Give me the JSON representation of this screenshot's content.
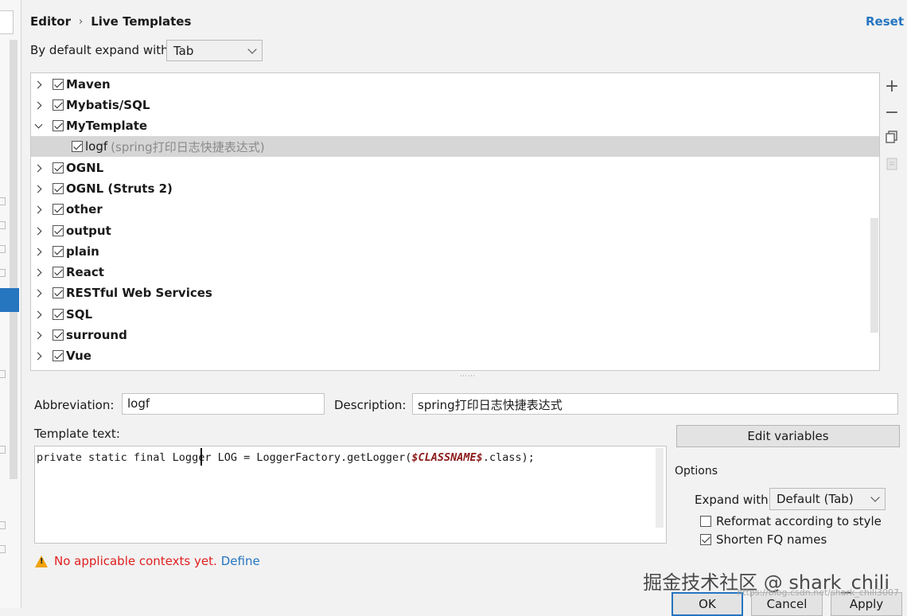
{
  "header": {
    "breadcrumb": [
      "Editor",
      "Live Templates"
    ],
    "breadcrumb_sep": "›",
    "reset_label": "Reset"
  },
  "expand_default": {
    "label": "By default expand with",
    "value": "Tab"
  },
  "tree": {
    "groups": [
      {
        "name": "Maven",
        "checked": true,
        "expanded": false
      },
      {
        "name": "Mybatis/SQL",
        "checked": true,
        "expanded": false
      },
      {
        "name": "MyTemplate",
        "checked": true,
        "expanded": true
      },
      {
        "name": "OGNL",
        "checked": true,
        "expanded": false
      },
      {
        "name": "OGNL (Struts 2)",
        "checked": true,
        "expanded": false
      },
      {
        "name": "other",
        "checked": true,
        "expanded": false
      },
      {
        "name": "output",
        "checked": true,
        "expanded": false
      },
      {
        "name": "plain",
        "checked": true,
        "expanded": false
      },
      {
        "name": "React",
        "checked": true,
        "expanded": false
      },
      {
        "name": "RESTful Web Services",
        "checked": true,
        "expanded": false
      },
      {
        "name": "SQL",
        "checked": true,
        "expanded": false
      },
      {
        "name": "surround",
        "checked": true,
        "expanded": false
      },
      {
        "name": "Vue",
        "checked": true,
        "expanded": false
      }
    ],
    "selected_item": {
      "abbreviation": "logf",
      "description": "(spring打印日志快捷表达式)",
      "checked": true
    }
  },
  "side_tools": [
    "add-icon",
    "remove-icon",
    "copy-icon",
    "restore-icon"
  ],
  "form": {
    "abbreviation_label": "Abbreviation:",
    "abbreviation_value": "logf",
    "description_label": "Description:",
    "description_value": "spring打印日志快捷表达式",
    "template_text_label": "Template text:",
    "template_code_before": "private static final Logger LOG = LoggerFactory.getLogger(",
    "template_var": "$CLASSNAME$",
    "template_code_after": ".class);",
    "edit_variables_label": "Edit variables"
  },
  "options": {
    "title": "Options",
    "expand_with_label": "Expand with",
    "expand_with_value": "Default (Tab)",
    "reformat_label": "Reformat according to style",
    "reformat_checked": false,
    "shorten_label": "Shorten FQ names",
    "shorten_checked": true
  },
  "context": {
    "warning_text": "No applicable contexts yet.",
    "define_label": "Define"
  },
  "footer": {
    "ok_label": "OK",
    "cancel_label": "Cancel",
    "apply_label": "Apply"
  },
  "watermark": "掘金技术社区 @ shark_chili",
  "watermark_url": "https://blog.csdn.net/shark_chili3007",
  "colors": {
    "accent": "#2675bf",
    "selection": "#d6d6d6",
    "warning_text": "#e02020",
    "template_var": "#8b1a1a"
  }
}
